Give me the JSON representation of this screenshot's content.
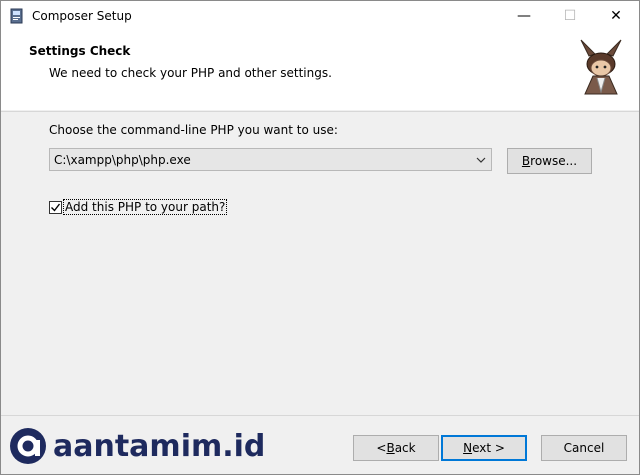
{
  "window": {
    "title": "Composer Setup",
    "controls": {
      "minimize": "—",
      "maximize": "☐",
      "close": "✕"
    }
  },
  "header": {
    "title": "Settings Check",
    "subtitle": "We need to check your PHP and other settings."
  },
  "main": {
    "choose_label": "Choose the command-line PHP you want to use:",
    "php_path": "C:\\xampp\\php\\php.exe",
    "browse_prefix": "",
    "browse_accel": "B",
    "browse_rest": "rowse...",
    "add_path_checked": true,
    "add_path_label": "Add this PHP to your path?"
  },
  "footer": {
    "brand": "aantamim.id",
    "back_prefix": "< ",
    "back_accel": "B",
    "back_rest": "ack",
    "next_prefix": "",
    "next_accel": "N",
    "next_rest": "ext >",
    "cancel_label": "Cancel"
  },
  "colors": {
    "accent": "#0078d7",
    "brand": "#1e2a5e"
  }
}
